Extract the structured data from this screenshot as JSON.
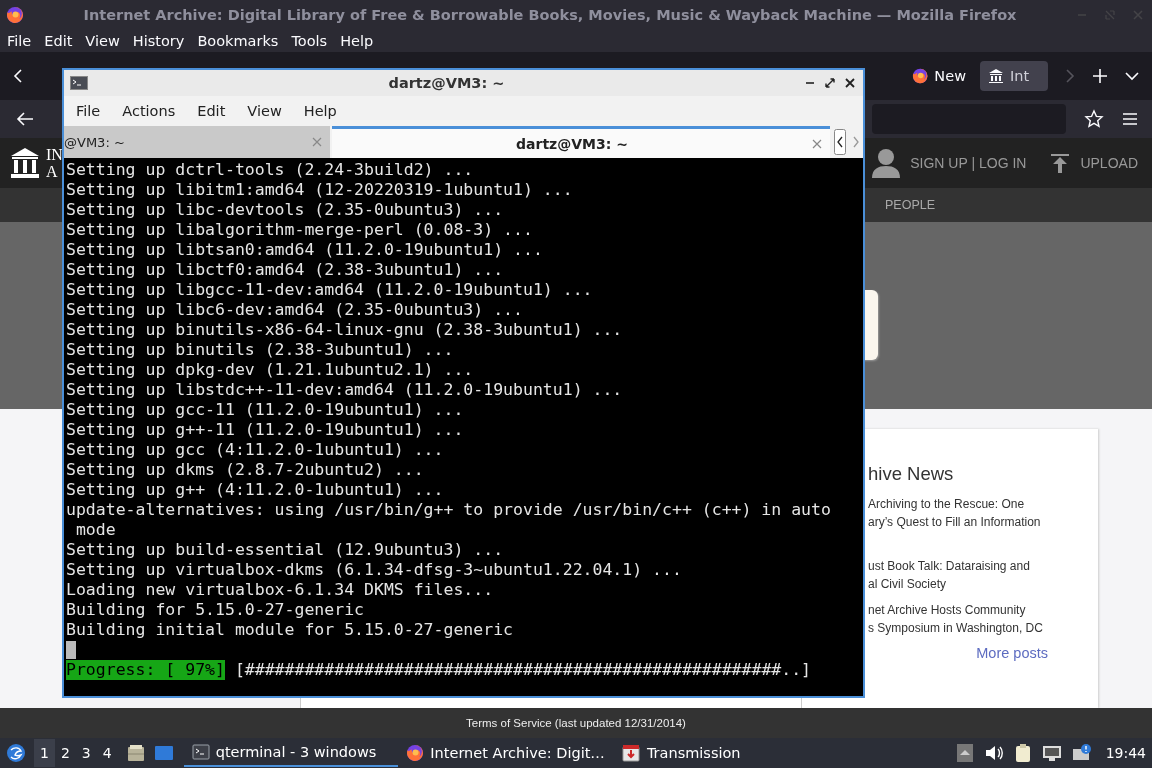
{
  "firefox": {
    "title": "Internet Archive: Digital Library of Free & Borrowable Books, Movies, Music & Wayback Machine — Mozilla Firefox",
    "menu": [
      "File",
      "Edit",
      "View",
      "History",
      "Bookmarks",
      "Tools",
      "Help"
    ],
    "tabs": [
      {
        "label": "New",
        "kind": "firefox",
        "selected": false
      },
      {
        "label": "Int",
        "kind": "archive",
        "selected": true
      }
    ]
  },
  "site": {
    "logo_text": [
      "IN",
      "A"
    ],
    "account": "SIGN UP | LOG IN",
    "upload": "UPLOAD",
    "nav": [
      "PEOPLE"
    ],
    "news": {
      "title": "hive News",
      "items": [
        "Archiving to the Rescue: One\nary’s Quest to Fill an Information",
        "ust Book Talk: Dataraising and\nal Civil Society",
        "net Archive Hosts Community\ns Symposium in Washington, DC"
      ],
      "more": "More posts"
    },
    "footer": "Terms of Service (last updated 12/31/2014)"
  },
  "terminal": {
    "title": "dartz@VM3: ~",
    "menu": [
      "File",
      "Actions",
      "Edit",
      "View",
      "Help"
    ],
    "tabs": [
      {
        "label": "@VM3: ~",
        "selected": false
      },
      {
        "label": "dartz@VM3: ~",
        "selected": true
      }
    ],
    "lines": [
      "Setting up dctrl-tools (2.24-3build2) ...",
      "Setting up libitm1:amd64 (12-20220319-1ubuntu1) ...",
      "Setting up libc-devtools (2.35-0ubuntu3) ...",
      "Setting up libalgorithm-merge-perl (0.08-3) ...",
      "Setting up libtsan0:amd64 (11.2.0-19ubuntu1) ...",
      "Setting up libctf0:amd64 (2.38-3ubuntu1) ...",
      "Setting up libgcc-11-dev:amd64 (11.2.0-19ubuntu1) ...",
      "Setting up libc6-dev:amd64 (2.35-0ubuntu3) ...",
      "Setting up binutils-x86-64-linux-gnu (2.38-3ubuntu1) ...",
      "Setting up binutils (2.38-3ubuntu1) ...",
      "Setting up dpkg-dev (1.21.1ubuntu2.1) ...",
      "Setting up libstdc++-11-dev:amd64 (11.2.0-19ubuntu1) ...",
      "Setting up gcc-11 (11.2.0-19ubuntu1) ...",
      "Setting up g++-11 (11.2.0-19ubuntu1) ...",
      "Setting up gcc (4:11.2.0-1ubuntu1) ...",
      "Setting up dkms (2.8.7-2ubuntu2) ...",
      "Setting up g++ (4:11.2.0-1ubuntu1) ...",
      "update-alternatives: using /usr/bin/g++ to provide /usr/bin/c++ (c++) in auto",
      " mode",
      "Setting up build-essential (12.9ubuntu3) ...",
      "Setting up virtualbox-dkms (6.1.34-dfsg-3~ubuntu1.22.04.1) ...",
      "Loading new virtualbox-6.1.34 DKMS files...",
      "Building for 5.15.0-27-generic",
      "Building initial module for 5.15.0-27-generic"
    ],
    "cursor": true,
    "progress": {
      "label": "Progress: [ 97%]",
      "bar": " [######################################################..]"
    }
  },
  "taskbar": {
    "workspaces": [
      {
        "label": "1",
        "selected": true
      },
      {
        "label": "2",
        "selected": false
      },
      {
        "label": "3",
        "selected": false
      },
      {
        "label": "4",
        "selected": false
      }
    ],
    "tasks": [
      {
        "label": "qterminal - 3 windows",
        "kind": "terminal",
        "selected": true
      },
      {
        "label": "Internet Archive: Digit…",
        "kind": "firefox",
        "selected": false
      },
      {
        "label": "Transmission",
        "kind": "transmission",
        "selected": false
      }
    ],
    "clock": "19:44"
  }
}
